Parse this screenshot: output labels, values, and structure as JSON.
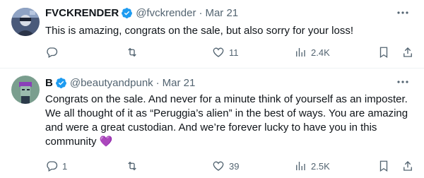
{
  "tweets": [
    {
      "name": "FVCKRENDER",
      "handle": "@fvckrender",
      "separator": "·",
      "date": "Mar 21",
      "text": "This is amazing, congrats on the sale, but also sorry for your loss!",
      "replies": "",
      "retweets": "",
      "likes": "11",
      "views": "2.4K"
    },
    {
      "name": "B",
      "handle": "@beautyandpunk",
      "separator": "·",
      "date": "Mar 21",
      "text": "Congrats on the sale. And never for a minute think of yourself as an imposter. We all thought of it as “Peruggia’s alien” in the best of ways. You are amazing and were a great custodian. And we’re forever lucky to have you in this community 💜",
      "replies": "1",
      "retweets": "",
      "likes": "39",
      "views": "2.5K"
    }
  ],
  "colors": {
    "verified": "#1d9bf0",
    "muted": "#536471",
    "text": "#0f1419",
    "divider": "#eff3f4"
  },
  "icons": [
    "verified-badge-icon",
    "more-icon",
    "reply-icon",
    "retweet-icon",
    "like-icon",
    "views-icon",
    "bookmark-icon",
    "share-icon"
  ]
}
